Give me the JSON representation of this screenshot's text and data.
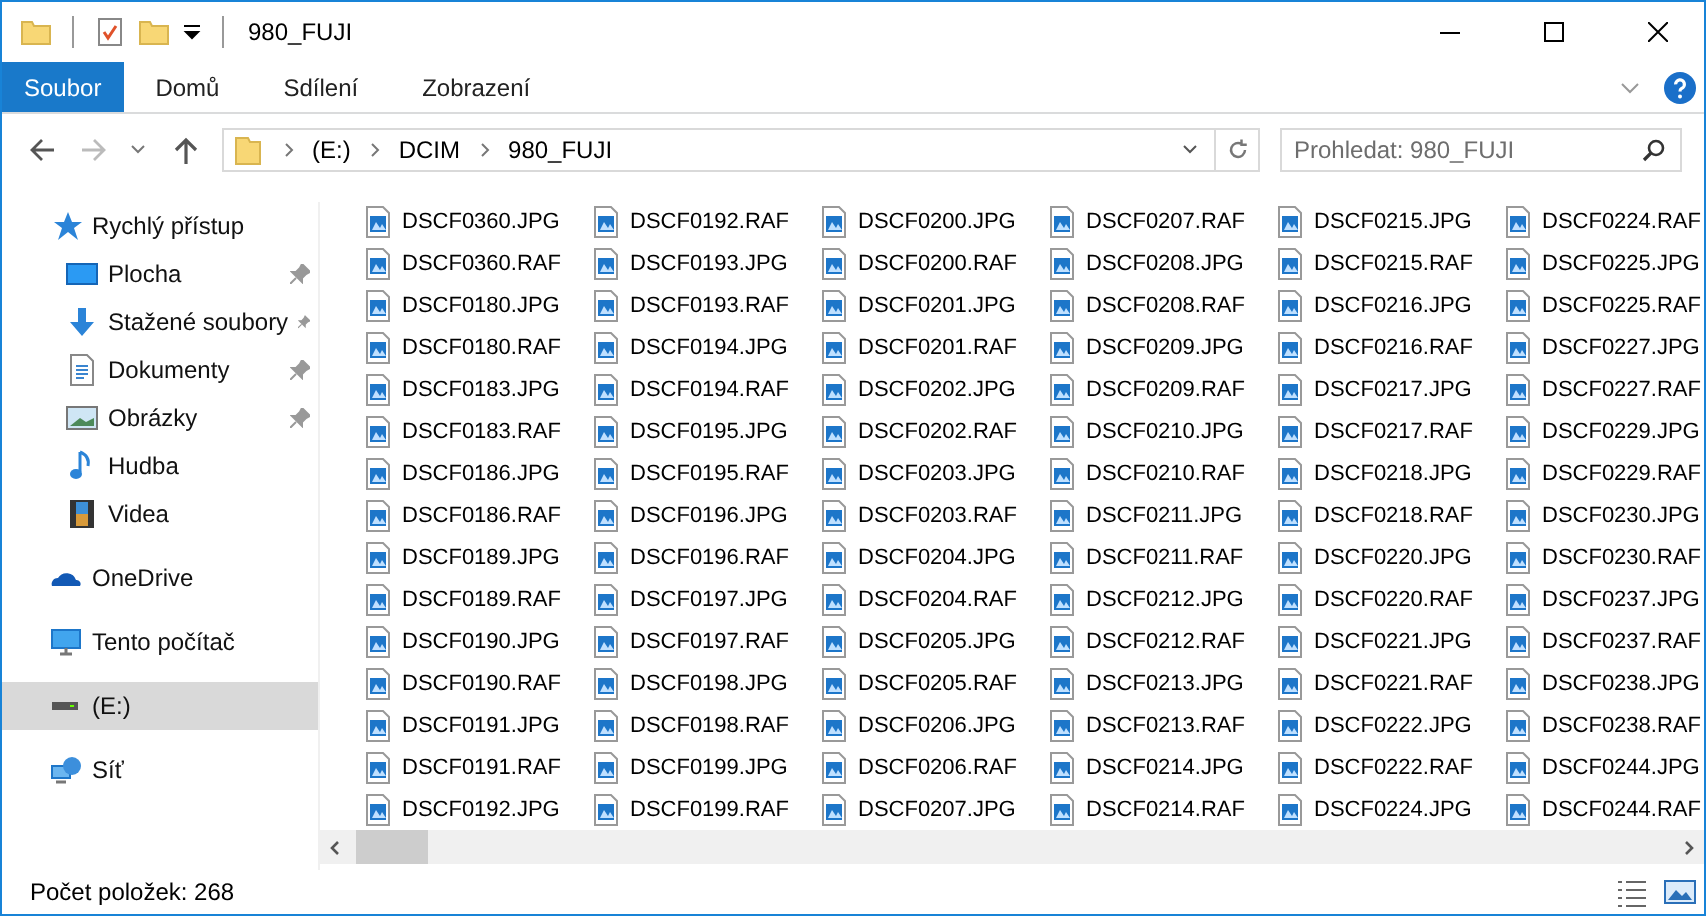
{
  "window": {
    "title": "980_FUJI"
  },
  "ribbon_tabs": [
    {
      "label": "Soubor",
      "selected": true
    },
    {
      "label": "Domů",
      "selected": false
    },
    {
      "label": "Sdílení",
      "selected": false
    },
    {
      "label": "Zobrazení",
      "selected": false
    }
  ],
  "address": {
    "path": [
      "(E:)",
      "DCIM",
      "980_FUJI"
    ]
  },
  "search": {
    "placeholder": "Prohledat: 980_FUJI"
  },
  "sidebar": {
    "items": [
      {
        "label": "Rychlý přístup",
        "selected": false,
        "children": [
          {
            "label": "Plocha",
            "pinned": true
          },
          {
            "label": "Stažené soubory",
            "pinned": true
          },
          {
            "label": "Dokumenty",
            "pinned": true
          },
          {
            "label": "Obrázky",
            "pinned": true
          },
          {
            "label": "Hudba",
            "pinned": false
          },
          {
            "label": "Videa",
            "pinned": false
          }
        ]
      },
      {
        "label": "OneDrive",
        "selected": false
      },
      {
        "label": "Tento počítač",
        "selected": false
      },
      {
        "label": "(E:)",
        "selected": true
      },
      {
        "label": "Síť",
        "selected": false
      }
    ]
  },
  "files": {
    "columns": [
      [
        "DSCF0360.JPG",
        "DSCF0360.RAF",
        "DSCF0180.JPG",
        "DSCF0180.RAF",
        "DSCF0183.JPG",
        "DSCF0183.RAF",
        "DSCF0186.JPG",
        "DSCF0186.RAF",
        "DSCF0189.JPG",
        "DSCF0189.RAF",
        "DSCF0190.JPG",
        "DSCF0190.RAF",
        "DSCF0191.JPG",
        "DSCF0191.RAF",
        "DSCF0192.JPG"
      ],
      [
        "DSCF0192.RAF",
        "DSCF0193.JPG",
        "DSCF0193.RAF",
        "DSCF0194.JPG",
        "DSCF0194.RAF",
        "DSCF0195.JPG",
        "DSCF0195.RAF",
        "DSCF0196.JPG",
        "DSCF0196.RAF",
        "DSCF0197.JPG",
        "DSCF0197.RAF",
        "DSCF0198.JPG",
        "DSCF0198.RAF",
        "DSCF0199.JPG",
        "DSCF0199.RAF"
      ],
      [
        "DSCF0200.JPG",
        "DSCF0200.RAF",
        "DSCF0201.JPG",
        "DSCF0201.RAF",
        "DSCF0202.JPG",
        "DSCF0202.RAF",
        "DSCF0203.JPG",
        "DSCF0203.RAF",
        "DSCF0204.JPG",
        "DSCF0204.RAF",
        "DSCF0205.JPG",
        "DSCF0205.RAF",
        "DSCF0206.JPG",
        "DSCF0206.RAF",
        "DSCF0207.JPG"
      ],
      [
        "DSCF0207.RAF",
        "DSCF0208.JPG",
        "DSCF0208.RAF",
        "DSCF0209.JPG",
        "DSCF0209.RAF",
        "DSCF0210.JPG",
        "DSCF0210.RAF",
        "DSCF0211.JPG",
        "DSCF0211.RAF",
        "DSCF0212.JPG",
        "DSCF0212.RAF",
        "DSCF0213.JPG",
        "DSCF0213.RAF",
        "DSCF0214.JPG",
        "DSCF0214.RAF"
      ],
      [
        "DSCF0215.JPG",
        "DSCF0215.RAF",
        "DSCF0216.JPG",
        "DSCF0216.RAF",
        "DSCF0217.JPG",
        "DSCF0217.RAF",
        "DSCF0218.JPG",
        "DSCF0218.RAF",
        "DSCF0220.JPG",
        "DSCF0220.RAF",
        "DSCF0221.JPG",
        "DSCF0221.RAF",
        "DSCF0222.JPG",
        "DSCF0222.RAF",
        "DSCF0224.JPG"
      ],
      [
        "DSCF0224.RAF",
        "DSCF0225.JPG",
        "DSCF0225.RAF",
        "DSCF0227.JPG",
        "DSCF0227.RAF",
        "DSCF0229.JPG",
        "DSCF0229.RAF",
        "DSCF0230.JPG",
        "DSCF0230.RAF",
        "DSCF0237.JPG",
        "DSCF0237.RAF",
        "DSCF0238.JPG",
        "DSCF0238.RAF",
        "DSCF0244.JPG",
        "DSCF0244.RAF"
      ]
    ]
  },
  "status_bar": {
    "text": "Počet položek: 268"
  }
}
